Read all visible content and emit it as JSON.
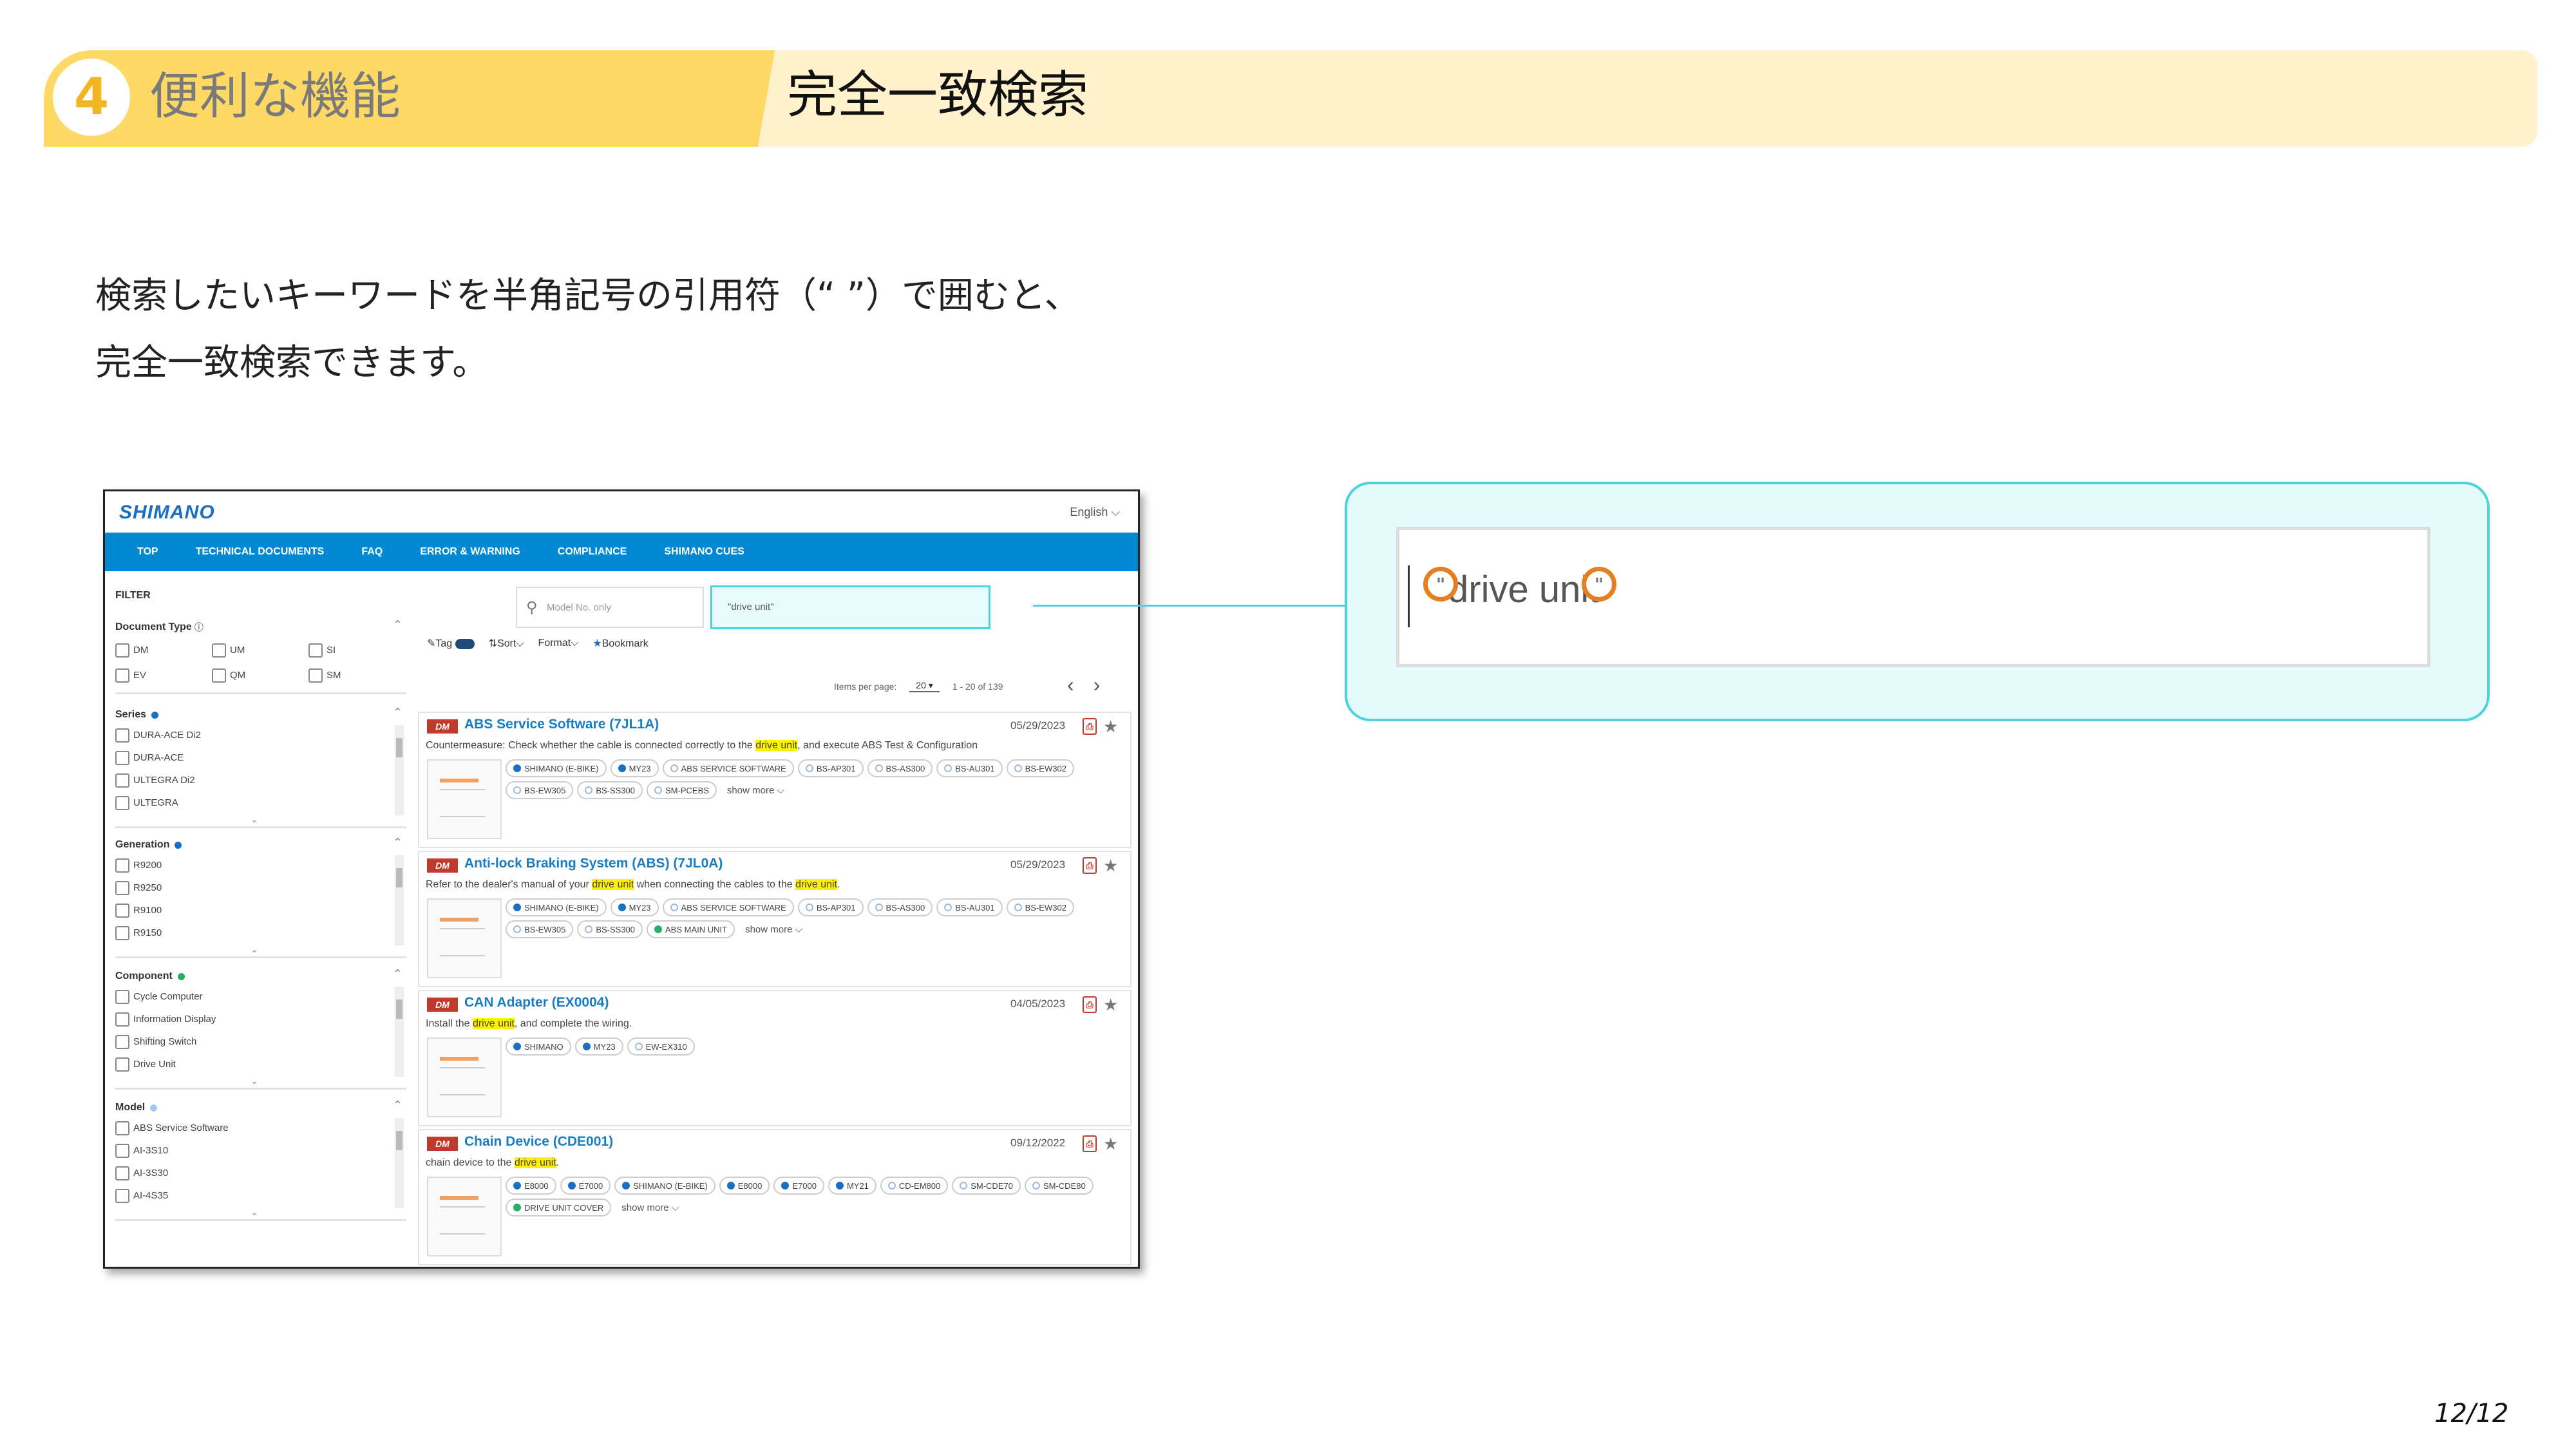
{
  "section": {
    "number": "4",
    "label": "便利な機能"
  },
  "slide_title": "完全一致検索",
  "body": {
    "line1": "検索したいキーワードを半角記号の引用符（“ ”）で囲むと、",
    "line2": "完全一致検索できます。"
  },
  "page_number": "12/12",
  "colors": {
    "header_left": "#fed966",
    "header_right": "#fff2cc",
    "accent": "#4ad2de",
    "nav": "#0089d2",
    "quote_marker": "#e67e22"
  },
  "screenshot": {
    "logo": "SHIMANO",
    "language": "English ⌵",
    "nav": [
      "TOP",
      "TECHNICAL DOCUMENTS",
      "FAQ",
      "ERROR & WARNING",
      "COMPLIANCE",
      "SHIMANO CUES"
    ],
    "filter_title": "FILTER",
    "document_type": {
      "title": "Document Type",
      "options": [
        "DM",
        "UM",
        "SI",
        "EV",
        "QM",
        "SM"
      ]
    },
    "series": {
      "title": "Series",
      "items": [
        "DURA-ACE Di2",
        "DURA-ACE",
        "ULTEGRA Di2",
        "ULTEGRA"
      ]
    },
    "generation": {
      "title": "Generation",
      "items": [
        "R9200",
        "R9250",
        "R9100",
        "R9150"
      ]
    },
    "component": {
      "title": "Component",
      "items": [
        "Cycle Computer",
        "Information Display",
        "Shifting Switch",
        "Drive Unit"
      ]
    },
    "model": {
      "title": "Model",
      "items": [
        "ABS Service Software",
        "AI-3S10",
        "AI-3S30",
        "AI-4S35"
      ]
    },
    "search": {
      "model_placeholder": "Model No. only",
      "query": "\"drive unit\""
    },
    "tools": {
      "tag": "Tag",
      "sort": "Sort⌵",
      "format": "Format⌵",
      "bookmark": "Bookmark"
    },
    "items_per_page_label": "Items per page:",
    "items_per_page": "20",
    "range": "1 - 20 of 139",
    "results": [
      {
        "badge": "DM",
        "title": "ABS Service Software (7JL1A)",
        "date": "05/29/2023",
        "desc_before": "Countermeasure: Check whether the cable is connected correctly to the ",
        "highlight": "drive unit",
        "desc_after": ", and execute ABS Test & Configuration",
        "tags": [
          {
            "label": "SHIMANO (E-BIKE)",
            "dot": "blue"
          },
          {
            "label": "MY23",
            "dot": "blue"
          },
          {
            "label": "ABS SERVICE SOFTWARE",
            "dot": "gray"
          },
          {
            "label": "BS-AP301",
            "dot": "gray"
          },
          {
            "label": "BS-AS300",
            "dot": "gray"
          },
          {
            "label": "BS-AU301",
            "dot": "gray"
          },
          {
            "label": "BS-EW302",
            "dot": "gray"
          },
          {
            "label": "BS-EW305",
            "dot": "gray"
          },
          {
            "label": "BS-SS300",
            "dot": "gray"
          },
          {
            "label": "SM-PCEBS",
            "dot": "gray"
          }
        ],
        "show_more": "show more ⌵"
      },
      {
        "badge": "DM",
        "title": "Anti-lock Braking System (ABS) (7JL0A)",
        "date": "05/29/2023",
        "desc_before": "Refer to the dealer's manual of your ",
        "highlight": "drive unit",
        "desc_after": " when connecting the cables to the ",
        "highlight2": "drive unit",
        "desc_end": ".",
        "tags": [
          {
            "label": "SHIMANO (E-BIKE)",
            "dot": "blue"
          },
          {
            "label": "MY23",
            "dot": "blue"
          },
          {
            "label": "ABS SERVICE SOFTWARE",
            "dot": "gray"
          },
          {
            "label": "BS-AP301",
            "dot": "gray"
          },
          {
            "label": "BS-AS300",
            "dot": "gray"
          },
          {
            "label": "BS-AU301",
            "dot": "gray"
          },
          {
            "label": "BS-EW302",
            "dot": "gray"
          },
          {
            "label": "BS-EW305",
            "dot": "gray"
          },
          {
            "label": "BS-SS300",
            "dot": "gray"
          },
          {
            "label": "ABS MAIN UNIT",
            "dot": "green"
          }
        ],
        "show_more": "show more ⌵"
      },
      {
        "badge": "DM",
        "title": "CAN Adapter (EX0004)",
        "date": "04/05/2023",
        "desc_before": "Install the ",
        "highlight": "drive unit",
        "desc_after": ", and complete the wiring.",
        "tags": [
          {
            "label": "SHIMANO",
            "dot": "blue"
          },
          {
            "label": "MY23",
            "dot": "blue"
          },
          {
            "label": "EW-EX310",
            "dot": "gray"
          }
        ],
        "show_more": ""
      },
      {
        "badge": "DM",
        "title": "Chain Device (CDE001)",
        "date": "09/12/2022",
        "desc_before": "chain device to the ",
        "highlight": "drive unit",
        "desc_after": ".",
        "tags": [
          {
            "label": "E8000",
            "dot": "blue"
          },
          {
            "label": "E7000",
            "dot": "blue"
          },
          {
            "label": "SHIMANO (E-BIKE)",
            "dot": "blue"
          },
          {
            "label": "E8000",
            "dot": "blue"
          },
          {
            "label": "E7000",
            "dot": "blue"
          },
          {
            "label": "MY21",
            "dot": "blue"
          },
          {
            "label": "CD-EM800",
            "dot": "gray"
          },
          {
            "label": "SM-CDE70",
            "dot": "gray"
          },
          {
            "label": "SM-CDE80",
            "dot": "gray"
          },
          {
            "label": "DRIVE UNIT COVER",
            "dot": "green"
          }
        ],
        "show_more": "show more ⌵"
      }
    ]
  },
  "zoom": {
    "text": "drive unit",
    "quote_open": "\"",
    "quote_close": "\""
  }
}
